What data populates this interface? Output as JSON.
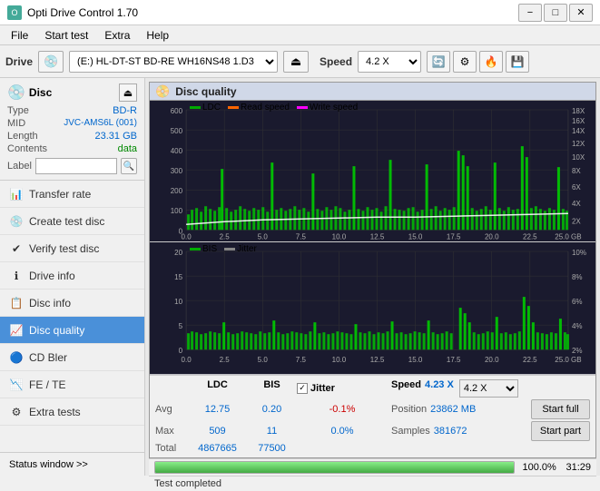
{
  "window": {
    "title": "Opti Drive Control 1.70",
    "controls": {
      "minimize": "−",
      "maximize": "□",
      "close": "✕"
    }
  },
  "menu": {
    "items": [
      "File",
      "Start test",
      "Extra",
      "Help"
    ]
  },
  "toolbar": {
    "drive_label": "Drive",
    "drive_value": "(E:)  HL-DT-ST BD-RE  WH16NS48 1.D3",
    "speed_label": "Speed",
    "speed_value": "4.2 X"
  },
  "disc": {
    "header": "Disc",
    "type_label": "Type",
    "type_value": "BD-R",
    "mid_label": "MID",
    "mid_value": "JVC-AMS6L (001)",
    "length_label": "Length",
    "length_value": "23.31 GB",
    "contents_label": "Contents",
    "contents_value": "data",
    "label_label": "Label"
  },
  "nav": {
    "items": [
      {
        "id": "transfer-rate",
        "label": "Transfer rate",
        "icon": "📊"
      },
      {
        "id": "create-test-disc",
        "label": "Create test disc",
        "icon": "💿"
      },
      {
        "id": "verify-test-disc",
        "label": "Verify test disc",
        "icon": "✔"
      },
      {
        "id": "drive-info",
        "label": "Drive info",
        "icon": "ℹ"
      },
      {
        "id": "disc-info",
        "label": "Disc info",
        "icon": "📋"
      },
      {
        "id": "disc-quality",
        "label": "Disc quality",
        "icon": "📈",
        "active": true
      },
      {
        "id": "cd-bler",
        "label": "CD Bler",
        "icon": "🔵"
      },
      {
        "id": "fe-te",
        "label": "FE / TE",
        "icon": "📉"
      },
      {
        "id": "extra-tests",
        "label": "Extra tests",
        "icon": "⚙"
      }
    ],
    "status_window": "Status window >>"
  },
  "disc_quality": {
    "title": "Disc quality",
    "chart1": {
      "legend": {
        "ldc": "LDC",
        "read": "Read speed",
        "write": "Write speed"
      },
      "y_max": 600,
      "y_labels_left": [
        "600",
        "500",
        "400",
        "300",
        "200",
        "100",
        "0"
      ],
      "y_labels_right": [
        "18X",
        "16X",
        "14X",
        "12X",
        "10X",
        "8X",
        "6X",
        "4X",
        "2X"
      ],
      "x_labels": [
        "0.0",
        "2.5",
        "5.0",
        "7.5",
        "10.0",
        "12.5",
        "15.0",
        "17.5",
        "20.0",
        "22.5",
        "25.0 GB"
      ]
    },
    "chart2": {
      "legend": {
        "bis": "BIS",
        "jitter": "Jitter"
      },
      "y_max": 20,
      "y_labels_left": [
        "20",
        "15",
        "10",
        "5",
        "0"
      ],
      "y_labels_right": [
        "10%",
        "8%",
        "6%",
        "4%",
        "2%"
      ],
      "x_labels": [
        "0.0",
        "2.5",
        "5.0",
        "7.5",
        "10.0",
        "12.5",
        "15.0",
        "17.5",
        "20.0",
        "22.5",
        "25.0 GB"
      ]
    }
  },
  "stats": {
    "col_headers": [
      "LDC",
      "BIS",
      "",
      "Jitter",
      "Speed",
      ""
    ],
    "avg_label": "Avg",
    "avg_ldc": "12.75",
    "avg_bis": "0.20",
    "avg_jitter": "-0.1%",
    "max_label": "Max",
    "max_ldc": "509",
    "max_bis": "11",
    "max_jitter": "0.0%",
    "total_label": "Total",
    "total_ldc": "4867665",
    "total_bis": "77500",
    "speed_label": "Speed",
    "speed_value": "4.23 X",
    "speed_dropdown": "4.2 X",
    "position_label": "Position",
    "position_value": "23862 MB",
    "samples_label": "Samples",
    "samples_value": "381672",
    "jitter_checkbox": true,
    "jitter_label": "Jitter",
    "btn_start_full": "Start full",
    "btn_start_part": "Start part"
  },
  "progress": {
    "percent": 100,
    "text": "100.0%",
    "time": "31:29"
  },
  "status": {
    "text": "Test completed"
  }
}
